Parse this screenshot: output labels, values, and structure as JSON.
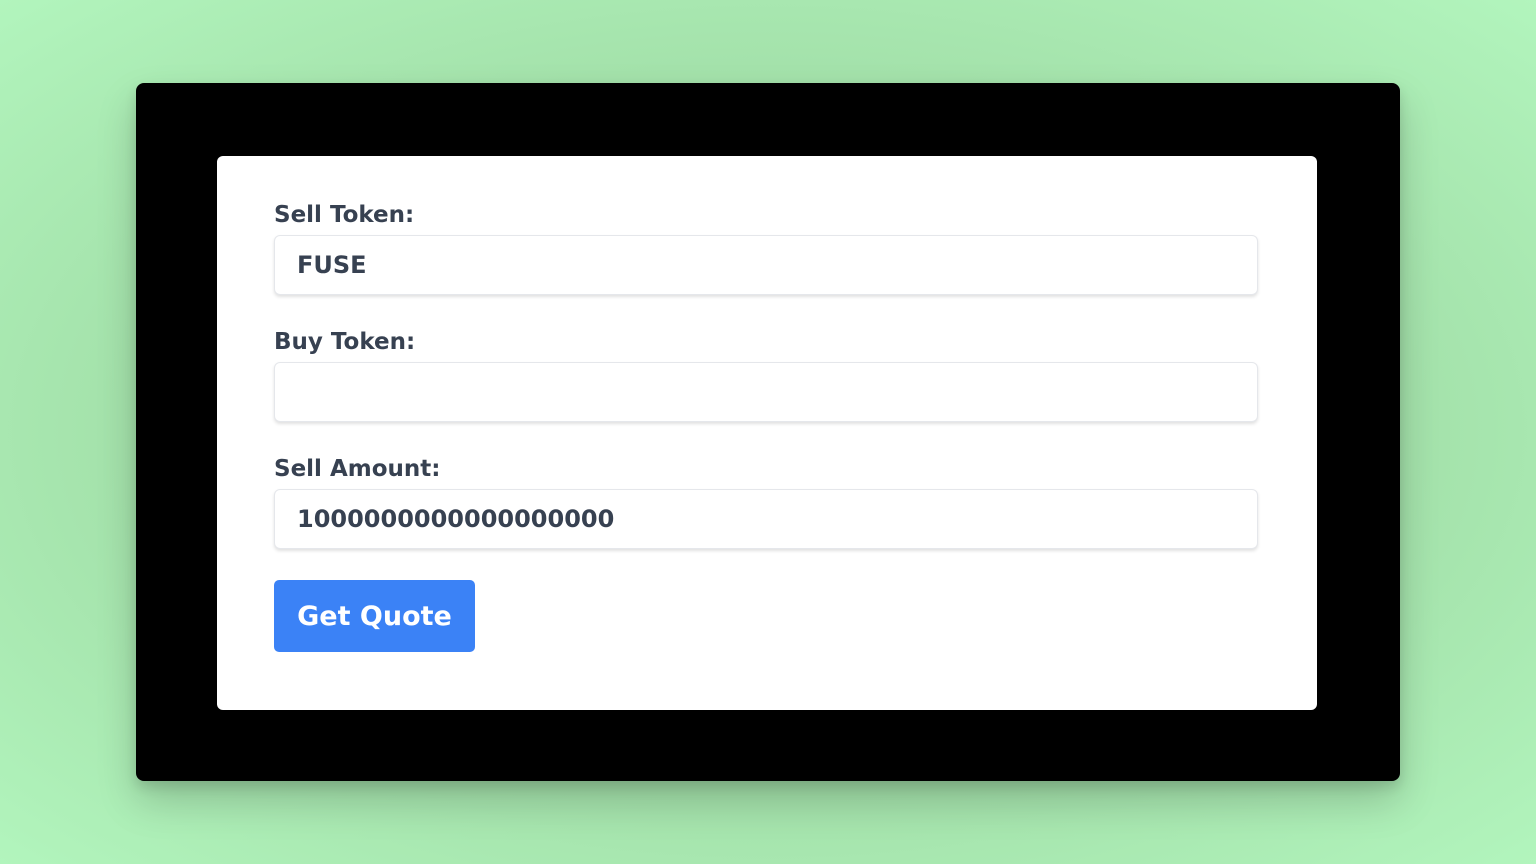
{
  "form": {
    "sell_token_label": "Sell Token:",
    "sell_token_value": "FUSE",
    "buy_token_label": "Buy Token:",
    "buy_token_value": "",
    "sell_amount_label": "Sell Amount:",
    "sell_amount_value": "1000000000000000000",
    "submit_label": "Get Quote"
  },
  "colors": {
    "background": "#a8e6ae",
    "frame": "#000000",
    "card": "#ffffff",
    "label_text": "#374151",
    "button": "#3b82f6",
    "button_text": "#ffffff"
  }
}
